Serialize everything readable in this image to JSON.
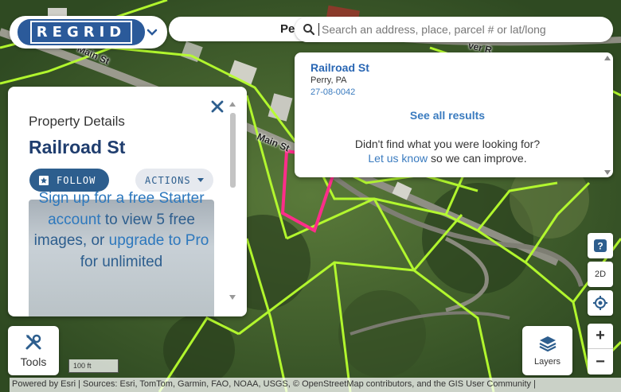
{
  "map": {
    "road_labels": [
      "Main St",
      "Main St"
    ],
    "road_partial": "ver R",
    "parcel_color": "#b8ff2e",
    "selected_parcel_color": "#ff2d8a"
  },
  "header": {
    "logo_text": "REGRID",
    "place_partial": "Pe",
    "search_placeholder": "Search an address, place, parcel # or lat/long"
  },
  "results": {
    "title": "Railroad St",
    "location": "Perry, PA",
    "parcel_id": "27-08-0042",
    "see_all": "See all results",
    "not_found": "Didn't find what you were looking for?",
    "let_us_know": "Let us know",
    "improve": " so we can improve."
  },
  "panel": {
    "label": "Property Details",
    "title": "Railroad St",
    "follow": "FOLLOW",
    "actions": "ACTIONS",
    "promo_signup": "Sign up for a free Starter account",
    "promo_rest1": " to view 5 free images, or ",
    "promo_upgrade": "upgrade to Pro",
    "promo_rest2": " for unlimited"
  },
  "controls": {
    "tools": "Tools",
    "layers": "Layers",
    "view_2d": "2D",
    "zoom_in": "+",
    "zoom_out": "−",
    "help": "?"
  },
  "scale": {
    "label": "100 ft"
  },
  "attribution": "Powered by Esri | Sources: Esri, TomTom, Garmin, FAO, NOAA, USGS, © OpenStreetMap contributors, and the GIS User Community |"
}
